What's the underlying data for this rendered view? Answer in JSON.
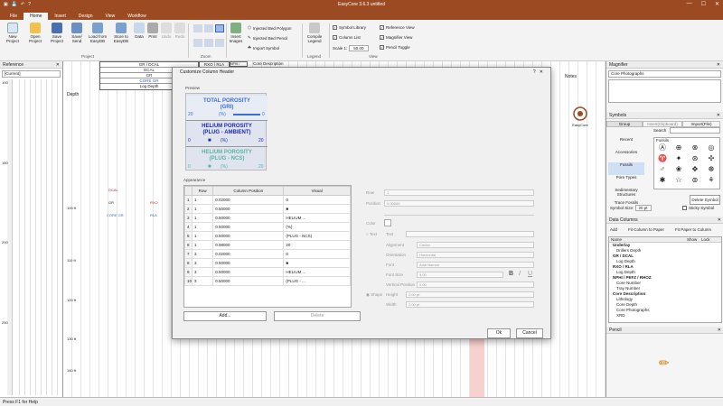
{
  "window": {
    "title": "EasyCore 3.6.3 untitled"
  },
  "menu": {
    "file": "File",
    "home": "Home",
    "insert": "Insert",
    "design": "Design",
    "view": "View",
    "workflow": "Workflow"
  },
  "ribbon": {
    "new_project": "New Project",
    "open_project": "Open Project",
    "save_project": "Save Project",
    "save_send": "Save/ Send",
    "load_from": "Load from EasyDB",
    "store_to": "Store to EasyDB",
    "data": "Data",
    "print": "Print",
    "undo": "Undo",
    "redo": "Redo",
    "insert_images": "Insert Images",
    "injected_bed_polygon": "Injected Bed Polygon",
    "injected_bed_pencil": "Injected Bed Pencil",
    "import_symbol": "Import Symbol",
    "compile_legend": "Compile Legend",
    "symbol_library": "Symbol Library",
    "reference_view": "Reference View",
    "column_list": "Column List",
    "magnifier_view": "Magnifier View",
    "pencil_toggle": "Pencil Toggle",
    "scale_label": "Scale 1:",
    "scale_value": "50.00",
    "group_project": "Project",
    "group_zoom": "Zoom",
    "group_legend": "Legend",
    "group_view": "View"
  },
  "left": {
    "title": "Reference",
    "combo": "[Current]",
    "depths": [
      "100",
      "150",
      "200",
      "250"
    ]
  },
  "main": {
    "headers": [
      "Depth",
      "GR / DCAL",
      "DCAL",
      "GR",
      "CORE GR",
      "RXO / RLA",
      "RXO",
      "RLA",
      "NPHI / PEFZ / RHOZ",
      "Core Description",
      "Log Depth",
      "Notes"
    ],
    "depth_labels": [
      "100 ft",
      "110 ft",
      "120 ft",
      "130 ft",
      "140 ft"
    ],
    "track_labels": [
      "DCAL",
      "GR",
      "CORE GR",
      "RXO",
      "RLA"
    ],
    "logo": "EasyCore"
  },
  "dialog": {
    "title": "Customize Column Header",
    "help": "?",
    "preview_label": "Preview",
    "appearance_label": "Appearance",
    "hdr1": {
      "title": "TOTAL POROSITY",
      "sub": "(GRI)",
      "left": "20",
      "unit": "(%)",
      "right": "0",
      "color": "#3a6ed8"
    },
    "hdr2": {
      "title": "HELIUM POROSITY",
      "sub": "(PLUG - AMBIENT)",
      "left": "0",
      "unit": "(%)",
      "right": "20",
      "color": "#1a2ab5"
    },
    "hdr3": {
      "title": "HELIUM POROSITY",
      "sub": "(PLUG - NCS)",
      "left": "0",
      "unit": "(%)",
      "right": "20",
      "color": "#5ab3a5"
    },
    "columns": [
      "Row",
      "Column Position",
      "Visual"
    ],
    "rows": [
      {
        "n": "1",
        "row": "1",
        "pos": "0.02000",
        "vis": "0"
      },
      {
        "n": "2",
        "row": "1",
        "pos": "0.50000",
        "vis": "■"
      },
      {
        "n": "3",
        "row": "1",
        "pos": "0.50000",
        "vis": "HELIUM ..."
      },
      {
        "n": "4",
        "row": "1",
        "pos": "0.50000",
        "vis": "(%)"
      },
      {
        "n": "5",
        "row": "1",
        "pos": "0.50000",
        "vis": "(PLUG - NCS)"
      },
      {
        "n": "6",
        "row": "1",
        "pos": "0.98000",
        "vis": "20"
      },
      {
        "n": "7",
        "row": "3",
        "pos": "0.02000",
        "vis": "0"
      },
      {
        "n": "8",
        "row": "3",
        "pos": "0.50000",
        "vis": "■"
      },
      {
        "n": "9",
        "row": "3",
        "pos": "0.50000",
        "vis": "HELIUM ..."
      },
      {
        "n": "10",
        "row": "3",
        "pos": "0.50000",
        "vis": "(PLUG - ..."
      }
    ],
    "add": "Add...",
    "delete": "Delete",
    "props": {
      "row": "Row",
      "row_val": "1",
      "position": "Position",
      "position_val": "0.00000",
      "color": "Color",
      "text_radio": "Text",
      "text": "Text",
      "alignment": "Alignment",
      "alignment_val": "Center",
      "orientation": "Orientation",
      "orientation_val": "Horizontal",
      "font": "Font",
      "font_val": "Arial Narrow",
      "font_size": "Font Size",
      "font_size_val": "9.00",
      "vposition": "Vertical Position",
      "vposition_val": "0.00",
      "shape_radio": "Shape",
      "height": "Height",
      "height_val": "2.00 pt",
      "width": "Width",
      "width_val": "2.00 pt",
      "bold": "B",
      "italic": "I",
      "underline": "U"
    },
    "ok": "Ok",
    "cancel": "Cancel"
  },
  "right": {
    "magnifier": "Magnifier",
    "magnifier_combo": "Core Photographs",
    "symbols": "Symbols",
    "tab_group": "Group",
    "tab_insert_clip": "Insert(Clipboard)",
    "tab_import": "Import(File)",
    "search": "Search",
    "groups": [
      "Recent",
      "Accessories",
      "Fossils",
      "Pore Types",
      "Sedimentary Structures",
      "Trace Fossils"
    ],
    "fossils_title": "Fossils",
    "delete_symbol": "Delete Symbol",
    "symbol_size_label": "Symbol Size:",
    "symbol_size": "20 pt",
    "sticky": "Sticky Symbol",
    "data_columns": "Data Columns",
    "add": "Add",
    "fit_col_to_paper": "Fit Column to Paper",
    "fit_paper_to_col": "Fit Paper to Column",
    "col_name": "Name",
    "col_show": "Show",
    "col_lock": "Lock",
    "tree": [
      "Underlay",
      "Drillers Depth",
      "GR / DCAL",
      "Log Depth",
      "RXO / RLA",
      "Log Depth",
      "NPHI / PEFZ / RHOZ",
      "Core Number",
      "Tray Number",
      "Core Description",
      "Lithology",
      "Core Depth",
      "Core Photographs",
      "XRD"
    ],
    "pencil": "Pencil"
  },
  "status": "Press F1 for Help"
}
